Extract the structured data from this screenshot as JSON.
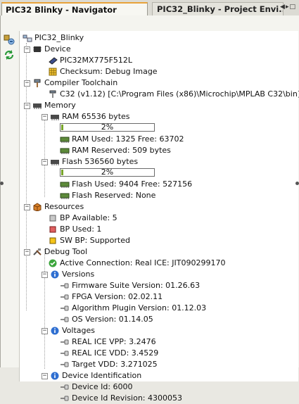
{
  "tabs": [
    {
      "label": "PIC32 Blinky - Navigator"
    },
    {
      "label": "PIC32_Blinky - Project Envi..."
    }
  ],
  "tab_controls": "◀▸□",
  "tree": {
    "root": "PIC32_Blinky",
    "device": {
      "label": "Device",
      "name": "PIC32MX775F512L",
      "checksum": "Checksum: Debug Image"
    },
    "compiler": {
      "label": "Compiler Toolchain",
      "c32": "C32 (v1.12) [C:\\Program Files (x86)\\Microchip\\MPLAB C32\\bin]"
    },
    "memory": {
      "label": "Memory",
      "ram": {
        "label": "RAM 65536 bytes",
        "percent_text": "2%",
        "percent": 2,
        "used": "RAM Used: 1325 Free: 63702",
        "reserved": "RAM Reserved: 509 bytes"
      },
      "flash": {
        "label": "Flash 536560 bytes",
        "percent_text": "2%",
        "percent": 2,
        "used": "Flash Used: 9404 Free: 527156",
        "reserved": "Flash Reserved: None"
      }
    },
    "resources": {
      "label": "Resources",
      "bp_available": "BP Available: 5",
      "bp_used": "BP Used: 1",
      "sw_bp": "SW BP: Supported"
    },
    "debug_tool": {
      "label": "Debug Tool",
      "connection": "Active Connection: Real ICE: JIT090299170",
      "versions": {
        "label": "Versions",
        "firmware": "Firmware Suite Version: 01.26.63",
        "fpga": "FPGA Version: 02.02.11",
        "algorithm": "Algorithm Plugin Version: 01.12.03",
        "os": "OS Version: 01.14.05"
      },
      "voltages": {
        "label": "Voltages",
        "vpp": "REAL ICE VPP: 3.2476",
        "vdd": "REAL ICE VDD: 3.4529",
        "target": "Target VDD: 3.271025"
      },
      "device_id": {
        "label": "Device Identification",
        "id": "Device Id: 6000",
        "revision": "Device Id Revision: 4300053"
      }
    }
  },
  "colors": {
    "tab_accent": "#e8a33a",
    "bar_fill": "#78a52a",
    "ok_green": "#3ba53b",
    "info_blue": "#2f6fd1"
  }
}
